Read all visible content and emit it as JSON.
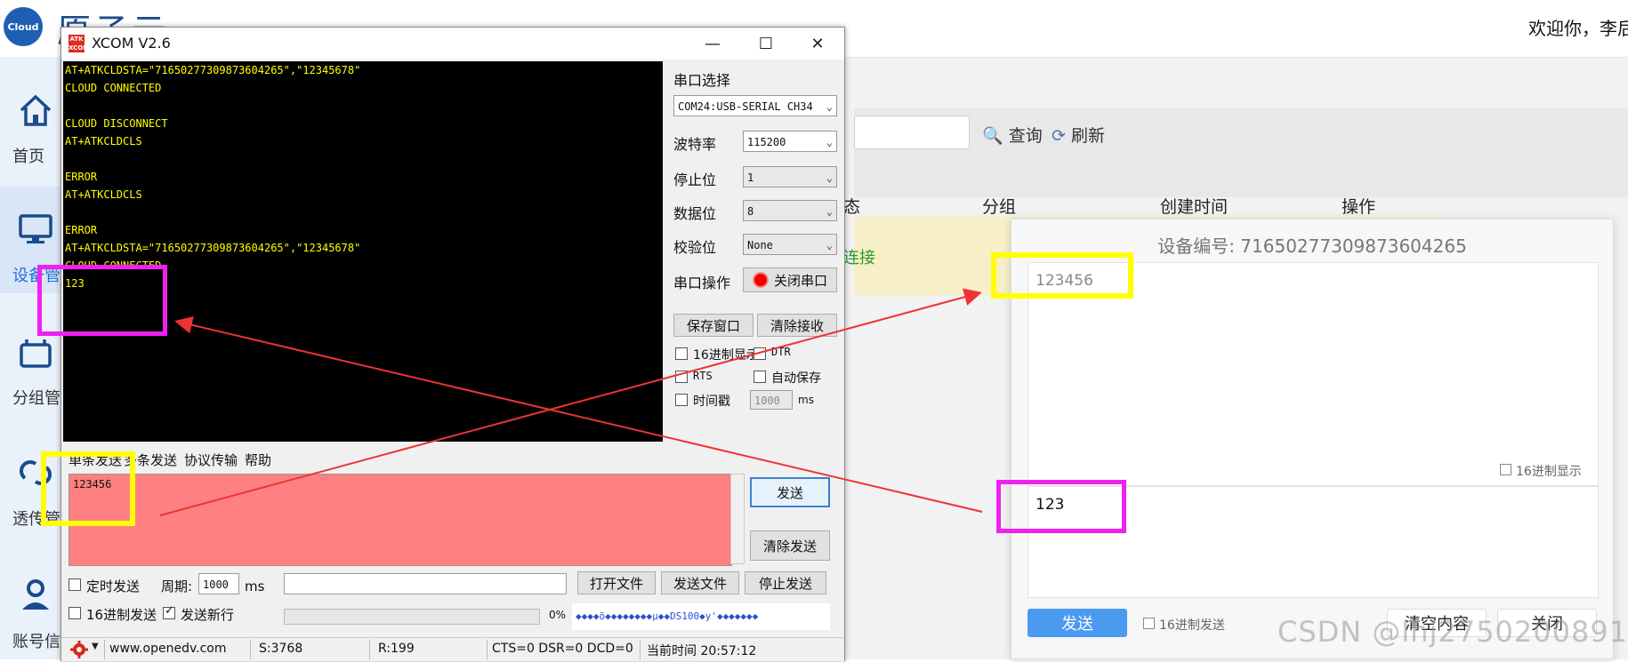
{
  "app": {
    "logo_text": "Cloud",
    "brand": "原子云",
    "welcome": "欢迎你，李后宝",
    "nav": [
      {
        "label": "首页",
        "icon": "home-icon"
      },
      {
        "label": "设备管",
        "icon": "monitor-icon"
      },
      {
        "label": "分组管",
        "icon": "folder-icon"
      },
      {
        "label": "透传管",
        "icon": "link-icon"
      },
      {
        "label": "账号信",
        "icon": "user-icon"
      }
    ],
    "toolbar": {
      "query": "查询",
      "refresh": "刷新"
    },
    "table": {
      "columns": [
        "态",
        "分组",
        "创建时间",
        "操作"
      ],
      "row_status": "连接"
    }
  },
  "xcom": {
    "title": "XCOM V2.6",
    "logo": "ATK XCOM",
    "terminal_lines": [
      "AT+ATKCLDSTA=\"71650277309873604265\",\"12345678\"",
      "CLOUD CONNECTED",
      "",
      "CLOUD DISCONNECT",
      "AT+ATKCLDCLS",
      "",
      "ERROR",
      "AT+ATKCLDCLS",
      "",
      "ERROR",
      "AT+ATKCLDSTA=\"71650277309873604265\",\"12345678\"",
      "CLOUD CONNECTED",
      "123"
    ],
    "port_select_label": "串口选择",
    "port_value": "COM24:USB-SERIAL CH34",
    "baud_label": "波特率",
    "baud_value": "115200",
    "stop_label": "停止位",
    "stop_value": "1",
    "data_label": "数据位",
    "data_value": "8",
    "parity_label": "校验位",
    "parity_value": "None",
    "port_op_label": "串口操作",
    "close_port": "关闭串口",
    "save_window": "保存窗口",
    "clear_recv": "清除接收",
    "hex_display": "16进制显示",
    "dtr": "DTR",
    "rts": "RTS",
    "auto_save": "自动保存",
    "timestamp": "时间戳",
    "timestamp_value": "1000",
    "ms": "ms",
    "tabs": [
      "单条发送",
      "多条发送",
      "协议传输",
      "帮助"
    ],
    "send_text": "123456",
    "send_btn": "发送",
    "clear_send": "清除发送",
    "timed_send": "定时发送",
    "period_label": "周期:",
    "period_value": "1000",
    "period_unit": "ms",
    "open_file": "打开文件",
    "send_file": "发送文件",
    "stop_send": "停止发送",
    "hex_send": "16进制发送",
    "send_newline": "发送新行",
    "progress": "0%",
    "ad_text": "◆◆◆◆õ◆◆◆◆◆◆◆◆µ◆◆DS100◆y'◆◆◆◆◆◆◆",
    "status": {
      "url": "www.openedv.com",
      "s": "S:3768",
      "r": "R:199",
      "lines": "CTS=0 DSR=0 DCD=0",
      "time": "当前时间 20:57:12"
    },
    "colors": {
      "terminal_bg": "#000000",
      "terminal_fg": "#ffff00",
      "send_bg": "#ff8080"
    }
  },
  "dialog": {
    "title": "设备编号: 71650277309873604265",
    "received": "123456",
    "hex_display": "16进制显示",
    "input": "123",
    "send": "发送",
    "hex_send": "16进制发送",
    "clear": "清空内容",
    "close": "关闭"
  },
  "watermark": "CSDN @lhj2750200891",
  "annotation_colors": {
    "yellow": "#ffff00",
    "magenta": "#f020f0",
    "arrow": "#ee3333"
  }
}
